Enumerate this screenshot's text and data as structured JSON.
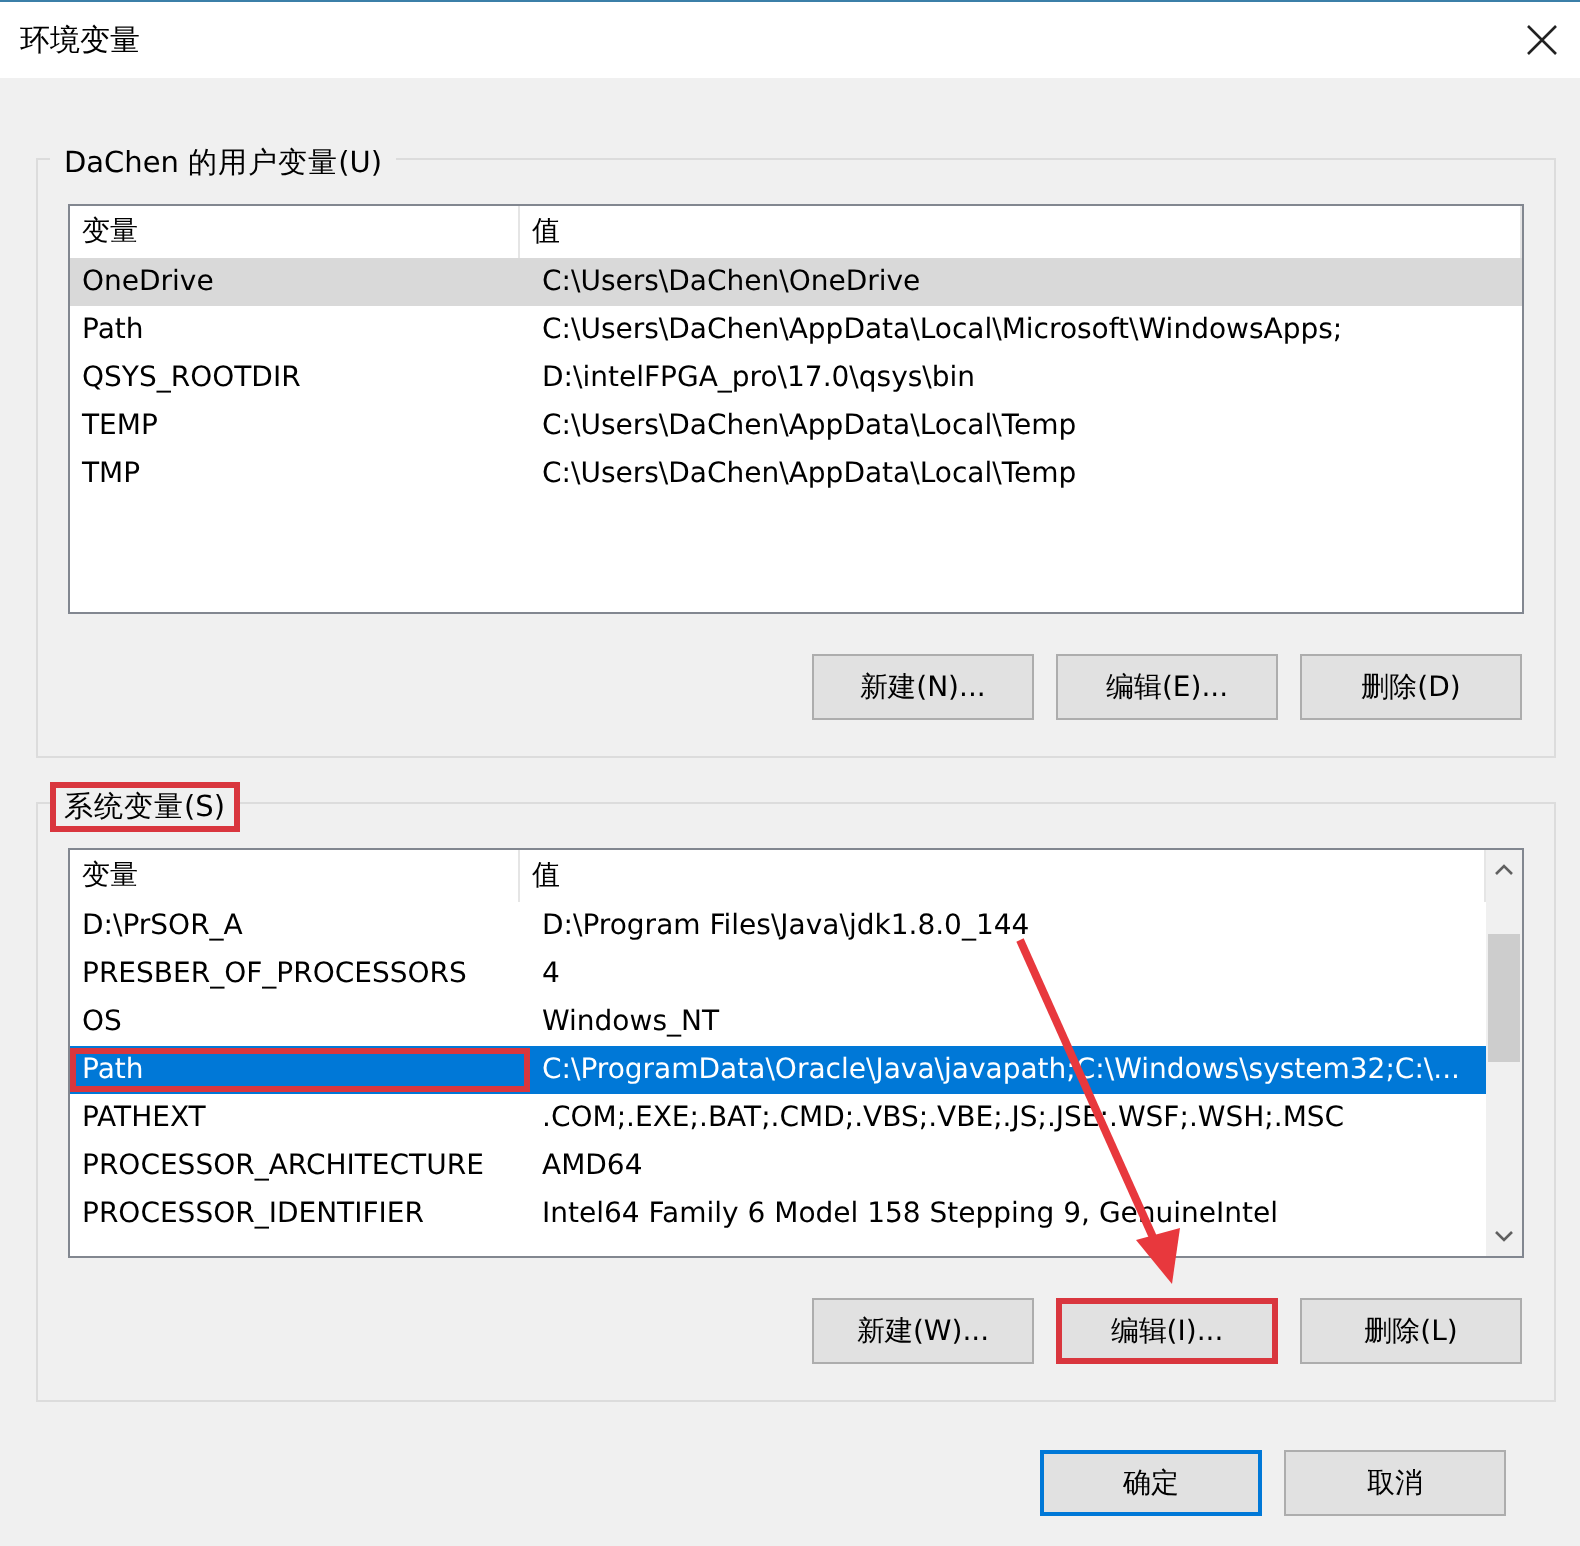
{
  "window": {
    "title": "环境变量"
  },
  "user_group": {
    "title": "DaChen 的用户变量(U)",
    "highlighted": false,
    "table": {
      "focused": false,
      "scrollbar": false,
      "columns": [
        "变量",
        "值"
      ],
      "rows": [
        {
          "name": "OneDrive",
          "value": "C:\\Users\\DaChen\\OneDrive",
          "selected": true,
          "highlighted": false
        },
        {
          "name": "Path",
          "value": "C:\\Users\\DaChen\\AppData\\Local\\Microsoft\\WindowsApps;",
          "selected": false,
          "highlighted": false
        },
        {
          "name": "QSYS_ROOTDIR",
          "value": "D:\\intelFPGA_pro\\17.0\\qsys\\bin",
          "selected": false,
          "highlighted": false
        },
        {
          "name": "TEMP",
          "value": "C:\\Users\\DaChen\\AppData\\Local\\Temp",
          "selected": false,
          "highlighted": false
        },
        {
          "name": "TMP",
          "value": "C:\\Users\\DaChen\\AppData\\Local\\Temp",
          "selected": false,
          "highlighted": false
        }
      ]
    },
    "buttons": [
      {
        "label": "新建(N)...",
        "highlighted": false
      },
      {
        "label": "编辑(E)...",
        "highlighted": false
      },
      {
        "label": "删除(D)",
        "highlighted": false
      }
    ]
  },
  "system_group": {
    "title": "系统变量(S)",
    "highlighted": true,
    "table": {
      "focused": true,
      "scrollbar": true,
      "columns": [
        "变量",
        "值"
      ],
      "rows": [
        {
          "name": "D:\\PrSOR_A",
          "value": "D:\\Program Files\\Java\\jdk1.8.0_144",
          "selected": false,
          "highlighted": false
        },
        {
          "name": "PRESBER_OF_PROCESSORS",
          "value": "4",
          "selected": false,
          "highlighted": false
        },
        {
          "name": "OS",
          "value": "Windows_NT",
          "selected": false,
          "highlighted": false
        },
        {
          "name": "Path",
          "value": "C:\\ProgramData\\Oracle\\Java\\javapath;C:\\Windows\\system32;C:\\...",
          "selected": true,
          "highlighted": true
        },
        {
          "name": "PATHEXT",
          "value": ".COM;.EXE;.BAT;.CMD;.VBS;.VBE;.JS;.JSE;.WSF;.WSH;.MSC",
          "selected": false,
          "highlighted": false
        },
        {
          "name": "PROCESSOR_ARCHITECTURE",
          "value": "AMD64",
          "selected": false,
          "highlighted": false
        },
        {
          "name": "PROCESSOR_IDENTIFIER",
          "value": "Intel64 Family 6 Model 158 Stepping 9, GenuineIntel",
          "selected": false,
          "highlighted": false
        }
      ]
    },
    "buttons": [
      {
        "label": "新建(W)...",
        "highlighted": false
      },
      {
        "label": "编辑(I)...",
        "highlighted": true
      },
      {
        "label": "删除(L)",
        "highlighted": false
      }
    ]
  },
  "footer_buttons": [
    {
      "label": "确定",
      "default": true
    },
    {
      "label": "取消",
      "default": false
    }
  ]
}
